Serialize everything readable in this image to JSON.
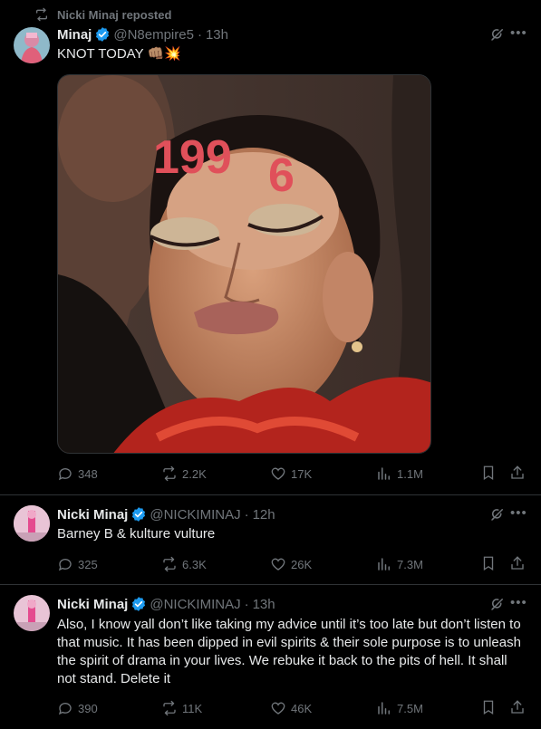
{
  "posts": [
    {
      "repost_label": "Nicki Minaj reposted",
      "name": "Minaj",
      "handle": "@N8empire5",
      "separator": "·",
      "time": "13h",
      "text": "KNOT TODAY 👊🏽💥",
      "image_overlay_text_1": "199",
      "image_overlay_text_2": "6",
      "stats": {
        "replies": "348",
        "reposts": "2.2K",
        "likes": "17K",
        "views": "1.1M"
      }
    },
    {
      "name": "Nicki Minaj",
      "handle": "@NICKIMINAJ",
      "separator": "·",
      "time": "12h",
      "text": "Barney B &  kulture vulture",
      "stats": {
        "replies": "325",
        "reposts": "6.3K",
        "likes": "26K",
        "views": "7.3M"
      }
    },
    {
      "name": "Nicki Minaj",
      "handle": "@NICKIMINAJ",
      "separator": "·",
      "time": "13h",
      "text": "Also, I know yall don’t like taking my advice until it’s too late but don’t listen to that music. It has been dipped in evil spirits & their sole purpose is to unleash the spirit of drama in your lives. We rebuke it back to the pits of hell. It shall not stand. Delete it",
      "stats": {
        "replies": "390",
        "reposts": "11K",
        "likes": "46K",
        "views": "7.5M"
      }
    }
  ],
  "icons": {
    "repost": "repost-icon",
    "verified": "verified-badge-icon",
    "grok": "grok-icon",
    "more": "more-icon",
    "reply": "reply-icon",
    "like": "like-icon",
    "views": "views-icon",
    "bookmark": "bookmark-icon",
    "share": "share-icon"
  },
  "colors": {
    "background": "#000000",
    "text": "#e7e9ea",
    "muted": "#71767b",
    "verified": "#1d9bf0",
    "divider": "#2f3336",
    "overlay_red": "#e0505a"
  }
}
